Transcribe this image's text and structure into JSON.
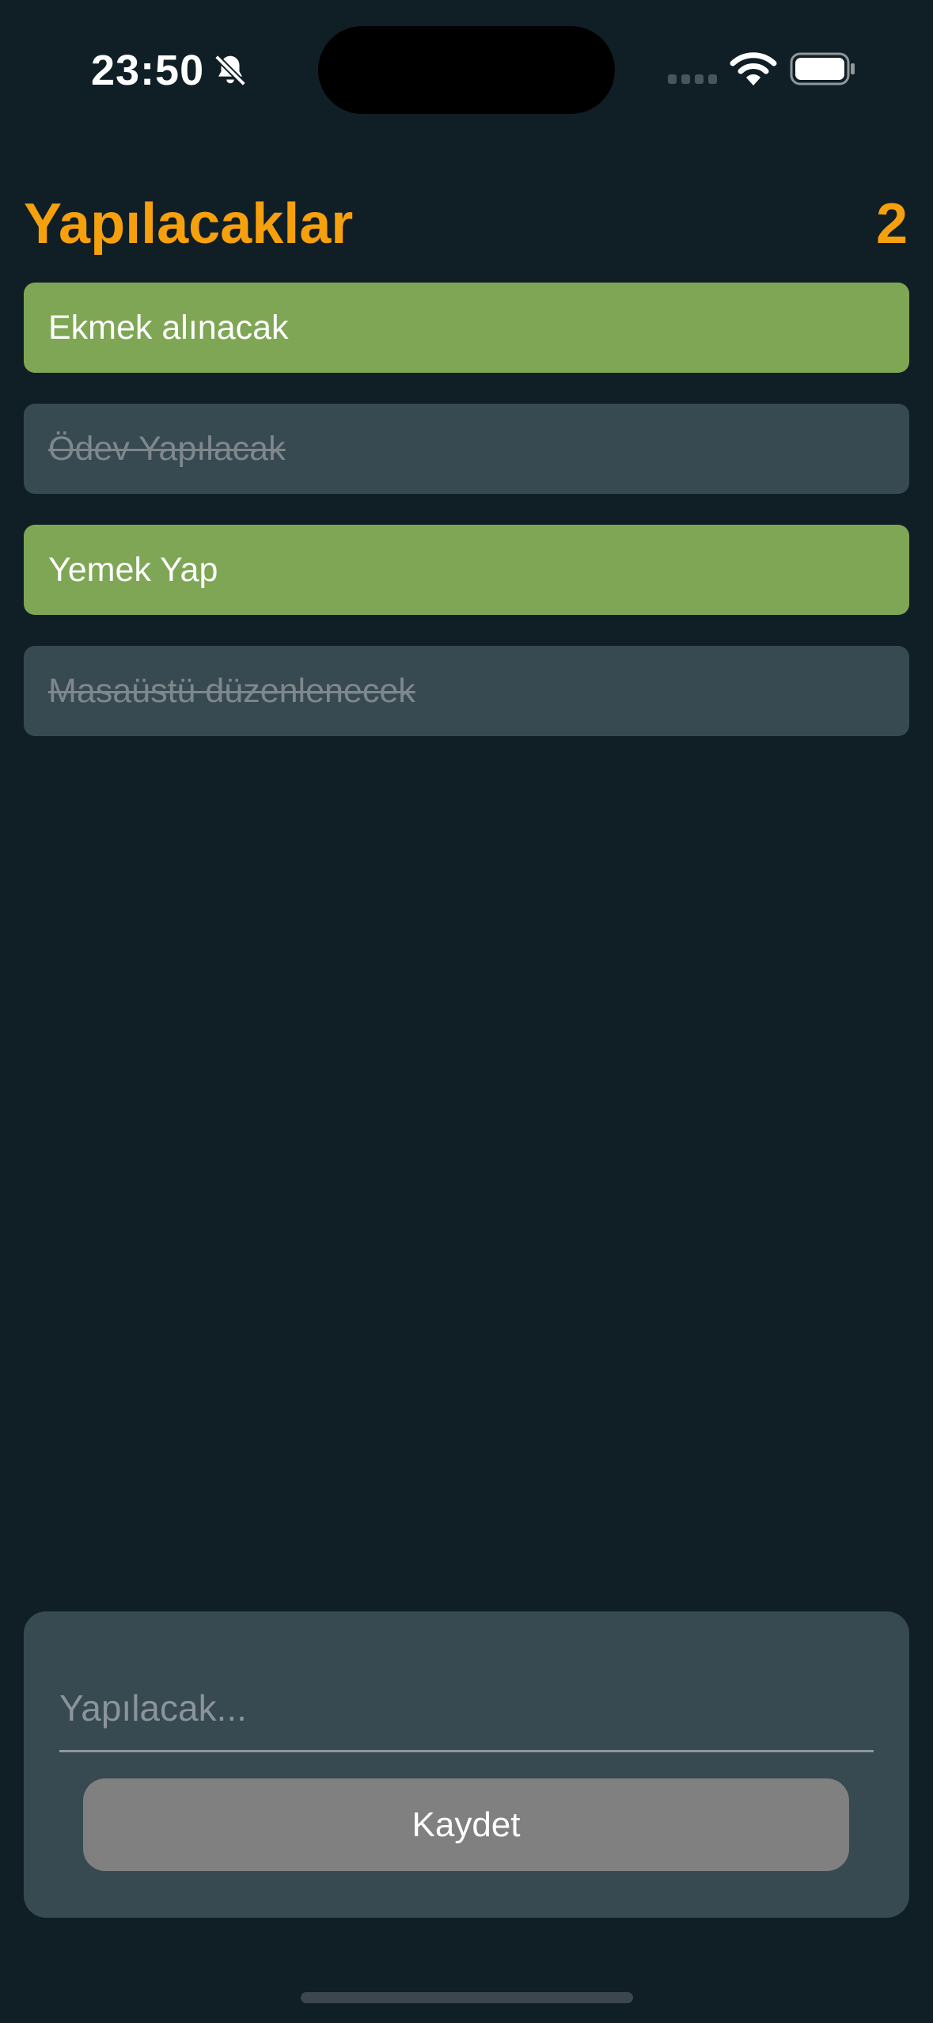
{
  "status_bar": {
    "time": "23:50",
    "icons": [
      "bell-slash-icon",
      "cellular-signal-icon",
      "wifi-icon",
      "battery-icon"
    ]
  },
  "header": {
    "title": "Yapılacaklar",
    "count": "2"
  },
  "todos": [
    {
      "text": "Ekmek alınacak",
      "done": false
    },
    {
      "text": "Ödev Yapılacak",
      "done": true
    },
    {
      "text": "Yemek Yap",
      "done": false
    },
    {
      "text": "Masaüstü düzenlenecek",
      "done": true
    }
  ],
  "form": {
    "input_placeholder": "Yapılacak...",
    "input_value": "",
    "save_label": "Kaydet"
  },
  "colors": {
    "background": "#101f26",
    "accent": "#f7a00e",
    "active_item": "#7fa654",
    "done_item": "#374951",
    "card": "#374951",
    "button": "#808080"
  }
}
